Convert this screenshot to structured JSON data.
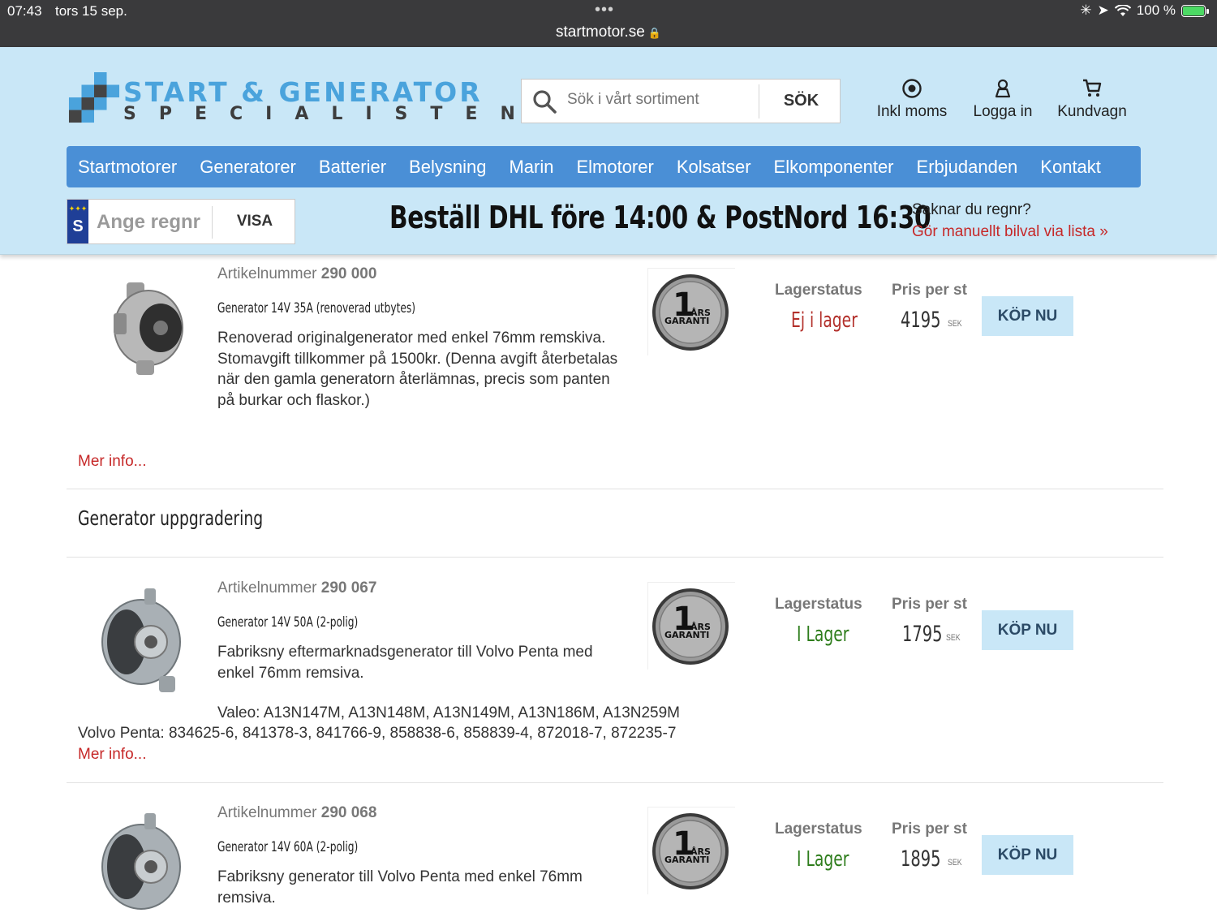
{
  "status": {
    "time": "07:43",
    "date": "tors 15 sep.",
    "battery": "100 %"
  },
  "browser": {
    "url": "startmotor.se"
  },
  "header": {
    "logo_title": "START & GENERATOR",
    "logo_sub": "SPECIALISTEN",
    "search_placeholder": "Sök i vårt sortiment",
    "search_button": "SÖK",
    "links": [
      "Inkl moms",
      "Logga in",
      "Kundvagn"
    ]
  },
  "nav": [
    "Startmotorer",
    "Generatorer",
    "Batterier",
    "Belysning",
    "Marin",
    "Elmotorer",
    "Kolsatser",
    "Elkomponenter",
    "Erbjudanden",
    "Kontakt"
  ],
  "regbox": {
    "country": "S",
    "placeholder": "Ange regnr",
    "button": "VISA"
  },
  "banner": {
    "text": "Beställ DHL före 14:00 & PostNord 16:30"
  },
  "missing": {
    "question": "Saknar du regnr?",
    "link": "Gör manuellt bilval via lista »"
  },
  "labels": {
    "article": "Artikelnummer",
    "stock": "Lagerstatus",
    "price": "Pris per st",
    "currency": "SEK",
    "buy": "KÖP NU",
    "more": "Mer info...",
    "badge_number": "1",
    "badge_top": "ÅRS",
    "badge_bottom": "GARANTI"
  },
  "section_title": "Generator uppgradering",
  "products": [
    {
      "article": "290 000",
      "name": "Generator 14V 35A (renoverad utbytes)",
      "description": "Renoverad originalgenerator med enkel 76mm remskiva. Stomavgift tillkommer på 1500kr. (Denna avgift återbetalas när den gamla generatorn återlämnas, precis som panten på burkar och flaskor.)",
      "stock": "Ej i lager",
      "stock_color": "#b3302b",
      "price": "4195"
    },
    {
      "article": "290 067",
      "name": "Generator 14V 50A (2-polig)",
      "description": "Fabriksny eftermarknadsgenerator till Volvo Penta med enkel 76mm remsiva.",
      "extra_1": "Valeo: A13N147M, A13N148M, A13N149M, A13N186M, A13N259M",
      "extra_2": "Volvo Penta: 834625-6, 841378-3, 841766-9, 858838-6, 858839-4, 872018-7, 872235-7",
      "stock": "I Lager",
      "stock_color": "#2e7d1c",
      "price": "1795"
    },
    {
      "article": "290 068",
      "name": "Generator 14V 60A (2-polig)",
      "description": "Fabriksny generator till Volvo Penta med enkel 76mm remsiva.",
      "stock": "I Lager",
      "stock_color": "#2e7d1c",
      "price": "1895"
    }
  ],
  "colors": {
    "header_bg": "#c9e7f7",
    "nav_bg": "#4a8fd6",
    "link_red": "#c62828",
    "logo_blue": "#4aa3dc"
  }
}
